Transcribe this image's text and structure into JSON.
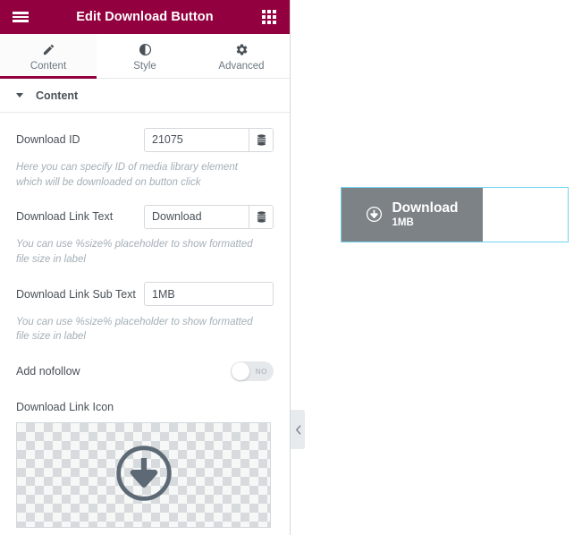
{
  "panel": {
    "header": {
      "title": "Edit Download Button",
      "menu_icon": "hamburger-icon",
      "apps_icon": "grid-apps-icon",
      "bg_color": "#93003f"
    },
    "tabs": [
      {
        "label": "Content",
        "icon": "pencil-icon",
        "active": true
      },
      {
        "label": "Style",
        "icon": "contrast-icon",
        "active": false
      },
      {
        "label": "Advanced",
        "icon": "gear-icon",
        "active": false
      }
    ],
    "section": {
      "title": "Content",
      "expanded": true,
      "caret_icon": "caret-down-icon"
    },
    "fields": {
      "download_id": {
        "label": "Download ID",
        "value": "21075",
        "placeholder": "",
        "media_icon": "media-library-icon",
        "hint": "Here you can specify ID of media library element which will be downloaded on button click"
      },
      "download_link_text": {
        "label": "Download Link Text",
        "value": "Download",
        "placeholder": "",
        "media_icon": "media-library-icon",
        "hint": "You can use %size% placeholder to show formatted file size in label"
      },
      "download_link_sub_text": {
        "label": "Download Link Sub Text",
        "value": "1MB",
        "placeholder": "",
        "hint": "You can use %size% placeholder to show formatted file size in label"
      },
      "add_nofollow": {
        "label": "Add nofollow",
        "state_label": "NO",
        "value": false
      },
      "download_link_icon": {
        "label": "Download Link Icon",
        "preview_icon": "download-circle-arrow-icon"
      }
    },
    "collapse_handle": {
      "icon": "chevron-left-icon"
    }
  },
  "canvas": {
    "widget": {
      "outline_color": "#71d3f0",
      "button": {
        "bg_color": "#7d8287",
        "icon": "download-circle-arrow-icon",
        "main_text": "Download",
        "sub_text": "1MB"
      }
    }
  }
}
